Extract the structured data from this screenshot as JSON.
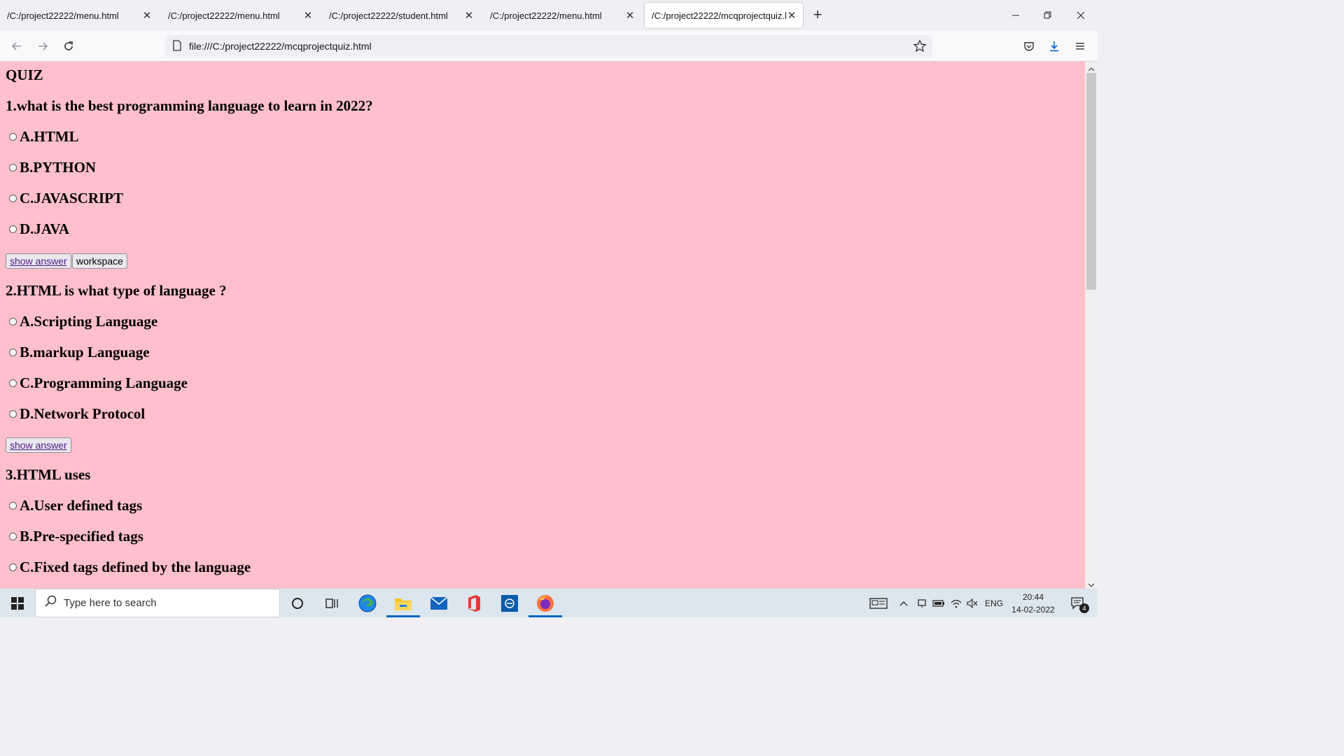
{
  "browser": {
    "tabs": [
      {
        "title": "/C:/project22222/menu.html",
        "active": false
      },
      {
        "title": "/C:/project22222/menu.html",
        "active": false
      },
      {
        "title": "/C:/project22222/student.html",
        "active": false
      },
      {
        "title": "/C:/project22222/menu.html",
        "active": false
      },
      {
        "title": "/C:/project22222/mcqprojectquiz.html",
        "active": true
      }
    ],
    "new_tab": "+",
    "url": "file:///C:/project22222/mcqprojectquiz.html"
  },
  "page": {
    "background": "#ffc0cb",
    "title": "QUIZ",
    "questions": [
      {
        "text": "1.what is the best programming language to learn in 2022?",
        "options": [
          "A.HTML",
          "B.PYTHON",
          "C.JAVASCRIPT",
          "D.JAVA"
        ],
        "buttons": [
          "show answer",
          "workspace"
        ]
      },
      {
        "text": "2.HTML is what type of language ?",
        "options": [
          "A.Scripting Language",
          "B.markup Language",
          "C.Programming Language",
          "D.Network Protocol"
        ],
        "buttons": [
          "show answer"
        ]
      },
      {
        "text": "3.HTML uses",
        "options": [
          "A.User defined tags",
          "B.Pre-specified tags",
          "C.Fixed tags defined by the language"
        ],
        "buttons": []
      }
    ]
  },
  "taskbar": {
    "search_placeholder": "Type here to search",
    "language": "ENG",
    "time": "20:44",
    "date": "14-02-2022",
    "notification_count": "4",
    "background": "#dbe6ee"
  }
}
